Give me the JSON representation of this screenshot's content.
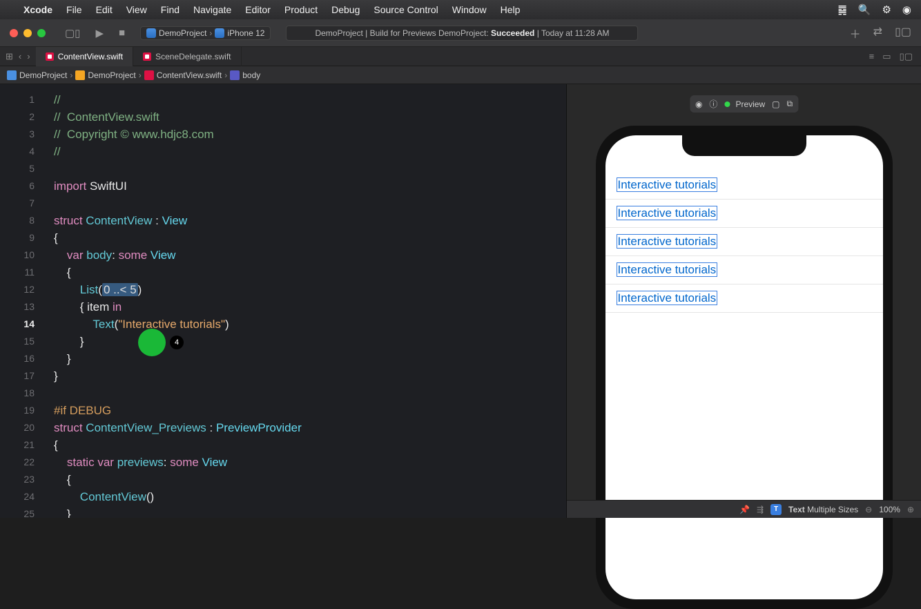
{
  "menubar": {
    "app": "Xcode",
    "items": [
      "File",
      "Edit",
      "View",
      "Find",
      "Navigate",
      "Editor",
      "Product",
      "Debug",
      "Source Control",
      "Window",
      "Help"
    ]
  },
  "window": {
    "scheme_project": "DemoProject",
    "scheme_device": "iPhone 12",
    "status_prefix": "DemoProject | Build for Previews DemoProject: ",
    "status_strong": "Succeeded",
    "status_suffix": " | Today at 11:28 AM"
  },
  "tabs": [
    {
      "label": "ContentView.swift",
      "active": true
    },
    {
      "label": "SceneDelegate.swift",
      "active": false
    }
  ],
  "crumbs": [
    "DemoProject",
    "DemoProject",
    "ContentView.swift",
    "body"
  ],
  "code": {
    "lines": [
      {
        "n": 1,
        "seg": [
          [
            "c-com",
            "//"
          ]
        ]
      },
      {
        "n": 2,
        "seg": [
          [
            "c-com",
            "//  ContentView.swift"
          ]
        ]
      },
      {
        "n": 3,
        "seg": [
          [
            "c-com",
            "//  Copyright © www.hdjc8.com"
          ]
        ]
      },
      {
        "n": 4,
        "seg": [
          [
            "c-com",
            "//"
          ]
        ]
      },
      {
        "n": 5,
        "seg": []
      },
      {
        "n": 6,
        "seg": [
          [
            "c-kw",
            "import"
          ],
          [
            "c-plain",
            " SwiftUI"
          ]
        ]
      },
      {
        "n": 7,
        "seg": []
      },
      {
        "n": 8,
        "seg": [
          [
            "c-kw",
            "struct"
          ],
          [
            "c-plain",
            " "
          ],
          [
            "c-id",
            "ContentView"
          ],
          [
            "c-plain",
            " : "
          ],
          [
            "c-type",
            "View"
          ]
        ]
      },
      {
        "n": 9,
        "seg": [
          [
            "c-plain",
            "{"
          ]
        ]
      },
      {
        "n": 10,
        "seg": [
          [
            "c-plain",
            "    "
          ],
          [
            "c-kw",
            "var"
          ],
          [
            "c-plain",
            " "
          ],
          [
            "c-id",
            "body"
          ],
          [
            "c-plain",
            ": "
          ],
          [
            "c-kw",
            "some"
          ],
          [
            "c-plain",
            " "
          ],
          [
            "c-type",
            "View"
          ]
        ]
      },
      {
        "n": 11,
        "seg": [
          [
            "c-plain",
            "    {"
          ]
        ]
      },
      {
        "n": 12,
        "seg": [
          [
            "c-plain",
            "        "
          ],
          [
            "c-id",
            "List"
          ],
          [
            "c-plain",
            "("
          ],
          [
            "sel",
            "0 ..< 5"
          ],
          [
            "c-plain",
            ")"
          ]
        ]
      },
      {
        "n": 13,
        "seg": [
          [
            "c-plain",
            "        { item "
          ],
          [
            "c-kw",
            "in"
          ]
        ]
      },
      {
        "n": 14,
        "seg": [
          [
            "c-plain",
            "            "
          ],
          [
            "c-id",
            "Text"
          ],
          [
            "c-plain",
            "("
          ],
          [
            "c-str",
            "\"Interactive tutorials\""
          ],
          [
            "c-plain",
            ")"
          ]
        ]
      },
      {
        "n": 15,
        "seg": [
          [
            "c-plain",
            "        }"
          ]
        ]
      },
      {
        "n": 16,
        "seg": [
          [
            "c-plain",
            "    }"
          ]
        ]
      },
      {
        "n": 17,
        "seg": [
          [
            "c-plain",
            "}"
          ]
        ]
      },
      {
        "n": 18,
        "seg": []
      },
      {
        "n": 19,
        "seg": [
          [
            "c-pre",
            "#if DEBUG"
          ]
        ]
      },
      {
        "n": 20,
        "seg": [
          [
            "c-kw",
            "struct"
          ],
          [
            "c-plain",
            " "
          ],
          [
            "c-id",
            "ContentView_Previews"
          ],
          [
            "c-plain",
            " : "
          ],
          [
            "c-type",
            "PreviewProvider"
          ]
        ]
      },
      {
        "n": 21,
        "seg": [
          [
            "c-plain",
            "{"
          ]
        ]
      },
      {
        "n": 22,
        "seg": [
          [
            "c-plain",
            "    "
          ],
          [
            "c-kw",
            "static"
          ],
          [
            "c-plain",
            " "
          ],
          [
            "c-kw",
            "var"
          ],
          [
            "c-plain",
            " "
          ],
          [
            "c-id",
            "previews"
          ],
          [
            "c-plain",
            ": "
          ],
          [
            "c-kw",
            "some"
          ],
          [
            "c-plain",
            " "
          ],
          [
            "c-type",
            "View"
          ]
        ]
      },
      {
        "n": 23,
        "seg": [
          [
            "c-plain",
            "    {"
          ]
        ]
      },
      {
        "n": 24,
        "seg": [
          [
            "c-plain",
            "        "
          ],
          [
            "c-id",
            "ContentView"
          ],
          [
            "c-plain",
            "()"
          ]
        ]
      },
      {
        "n": 25,
        "seg": [
          [
            "c-plain",
            "    }"
          ]
        ]
      }
    ],
    "current_line": 14,
    "inline_badge": "4"
  },
  "preview": {
    "label": "Preview",
    "list_items": [
      "Interactive tutorials",
      "Interactive tutorials",
      "Interactive tutorials",
      "Interactive tutorials",
      "Interactive tutorials"
    ]
  },
  "statusbar": {
    "type_label": "Text",
    "size_label": "Multiple Sizes",
    "zoom": "100%"
  }
}
